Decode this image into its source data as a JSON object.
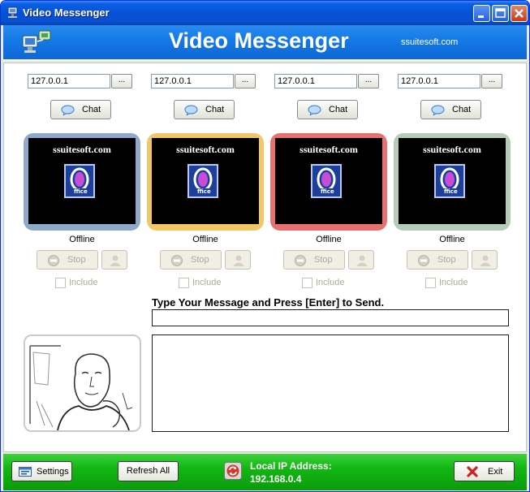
{
  "window": {
    "title": "Video Messenger"
  },
  "header": {
    "title": "Video Messenger",
    "site": "ssuitesoft.com"
  },
  "peers": [
    {
      "ip": "127.0.0.1",
      "browse_label": "...",
      "chat_label": "Chat",
      "video_site": "ssuitesoft.com",
      "status": "Offline",
      "stop_label": "Stop",
      "include_label": "Include",
      "frame_color": "#8ea9c9"
    },
    {
      "ip": "127.0.0.1",
      "browse_label": "...",
      "chat_label": "Chat",
      "video_site": "ssuitesoft.com",
      "status": "Offline",
      "stop_label": "Stop",
      "include_label": "Include",
      "frame_color": "#f2c766"
    },
    {
      "ip": "127.0.0.1",
      "browse_label": "...",
      "chat_label": "Chat",
      "video_site": "ssuitesoft.com",
      "status": "Offline",
      "stop_label": "Stop",
      "include_label": "Include",
      "frame_color": "#e87070"
    },
    {
      "ip": "127.0.0.1",
      "browse_label": "...",
      "chat_label": "Chat",
      "video_site": "ssuitesoft.com",
      "status": "Offline",
      "stop_label": "Stop",
      "include_label": "Include",
      "frame_color": "#b6ccb6"
    }
  ],
  "message": {
    "prompt": "Type Your Message and Press [Enter] to Send.",
    "value": ""
  },
  "footer": {
    "settings_label": "Settings",
    "refresh_label": "Refresh All",
    "ip_label": "Local IP Address:",
    "ip_value": "192.168.0.4",
    "exit_label": "Exit"
  },
  "colors": {
    "header": "#1479e6",
    "footer": "#13b513",
    "title_bar": "#0552d8"
  },
  "icons": {
    "title": "network-computer-icon",
    "chat": "speech-bubble-icon",
    "stop": "stop-icon",
    "record": "user-icon",
    "settings": "settings-icon",
    "ip": "refresh-network-icon",
    "exit": "close-x-icon"
  }
}
